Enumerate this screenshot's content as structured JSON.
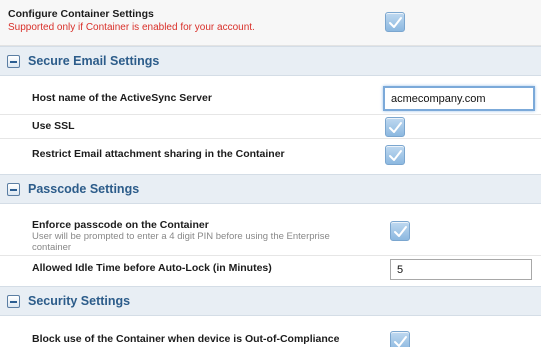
{
  "container": {
    "label": "Configure Container Settings",
    "note": "Supported only if Container is enabled for your account.",
    "checked": true
  },
  "sections": {
    "email": {
      "title": "Secure Email Settings",
      "host_label": "Host name of the ActiveSync Server",
      "host_value": "acmecompany.com",
      "ssl_label": "Use SSL",
      "ssl_checked": true,
      "attach_label": "Restrict Email attachment sharing in the Container",
      "attach_checked": true
    },
    "passcode": {
      "title": "Passcode Settings",
      "enforce_label": "Enforce passcode on the Container",
      "enforce_note": "User will be prompted to enter a 4 digit PIN before using the Enterprise container",
      "enforce_checked": true,
      "idle_label": "Allowed Idle Time before Auto-Lock (in Minutes)",
      "idle_value": "5"
    },
    "security": {
      "title": "Security Settings",
      "block_label": "Block use of the Container when device is Out-of-Compliance",
      "block_checked": true
    }
  },
  "colors": {
    "section_title": "#2c5c8a",
    "warning": "#d9302a",
    "checkbox": "#8cb8e0"
  }
}
